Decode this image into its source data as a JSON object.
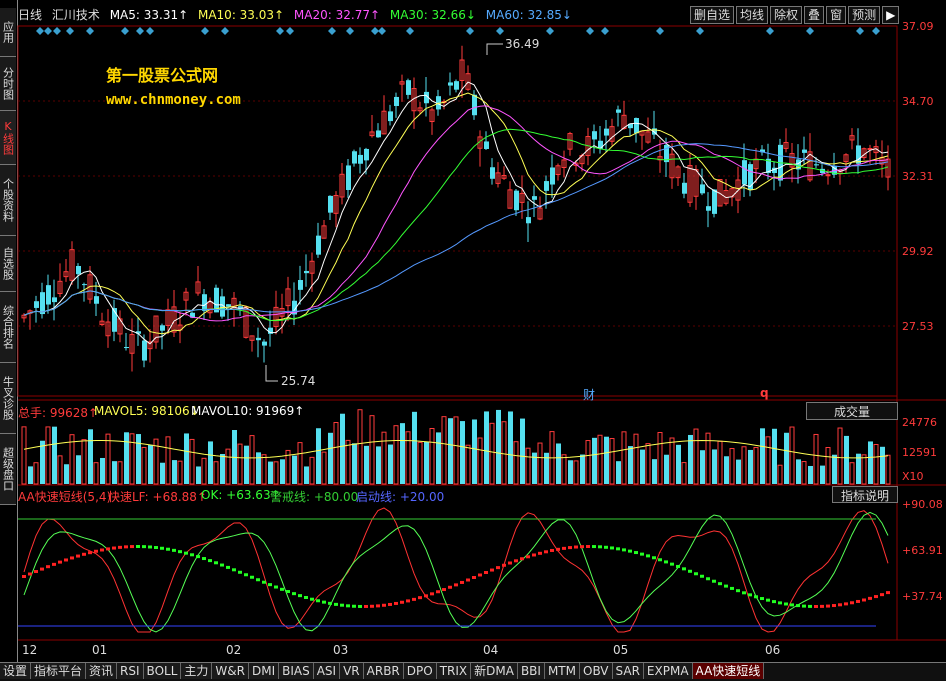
{
  "sidebar": {
    "tabs": [
      {
        "label": "应用",
        "active": false
      },
      {
        "label": "分时图",
        "active": false
      },
      {
        "label": "K线图",
        "active": true
      },
      {
        "label": "个股资料",
        "active": false
      },
      {
        "label": "自选股",
        "active": false
      },
      {
        "label": "综合排名",
        "active": false
      },
      {
        "label": "牛叉诊股",
        "active": false
      },
      {
        "label": "超级盘口",
        "active": false
      }
    ]
  },
  "header": {
    "period": "日线",
    "stock": "汇川技术",
    "ma5": "MA5: 33.31↑",
    "ma10": "MA10: 33.03↑",
    "ma20": "MA20: 32.77↑",
    "ma30": "MA30: 32.66↓",
    "ma60": "MA60: 32.85↓"
  },
  "toolbar": {
    "buttons": [
      "删自选",
      "均线",
      "除权",
      "叠",
      "窗",
      "预测"
    ],
    "arrow": "▶"
  },
  "watermark": {
    "line1": "第一股票公式网",
    "line2": "www.chnmoney.com"
  },
  "price_axis": [
    "37.09",
    "34.70",
    "32.31",
    "29.92",
    "27.53"
  ],
  "annotations": {
    "high": "36.49",
    "low": "25.74",
    "cai": "财",
    "q": "q"
  },
  "volume": {
    "total": "总手: 99628↑",
    "mavol5": "MAVOL5: 98106↓",
    "mavol10": "MAVOL10: 91969↑",
    "dropdown": "成交量",
    "axis": [
      "24776",
      "12591",
      "X10"
    ]
  },
  "indicator": {
    "title": "AA快速短线(5,4)",
    "fast": "快速LF: +68.88↑",
    "ok": "OK: +63.63↑",
    "warn": "警戒线: +80.00",
    "start": "启动线: +20.00",
    "button": "指标说明",
    "axis": [
      "+90.08",
      "+63.91",
      "+37.74"
    ]
  },
  "months": [
    "12",
    "01",
    "02",
    "03",
    "04",
    "05",
    "06"
  ],
  "bottom_tabs": [
    {
      "label": "设置",
      "active": false
    },
    {
      "label": "指标平台",
      "active": false
    },
    {
      "label": "资讯",
      "active": false
    },
    {
      "label": "RSI",
      "active": false
    },
    {
      "label": "BOLL",
      "active": false
    },
    {
      "label": "主力",
      "active": false
    },
    {
      "label": "W&R",
      "active": false
    },
    {
      "label": "DMI",
      "active": false
    },
    {
      "label": "BIAS",
      "active": false
    },
    {
      "label": "ASI",
      "active": false
    },
    {
      "label": "VR",
      "active": false
    },
    {
      "label": "ARBR",
      "active": false
    },
    {
      "label": "DPO",
      "active": false
    },
    {
      "label": "TRIX",
      "active": false
    },
    {
      "label": "新DMA",
      "active": false
    },
    {
      "label": "BBI",
      "active": false
    },
    {
      "label": "MTM",
      "active": false
    },
    {
      "label": "OBV",
      "active": false
    },
    {
      "label": "SAR",
      "active": false
    },
    {
      "label": "EXPMA",
      "active": false
    },
    {
      "label": "AA快速短线",
      "active": true
    }
  ],
  "colors": {
    "up": "#ff3b3b",
    "down": "#55e0f0",
    "ma5": "#ffffff",
    "ma10": "#ffff55",
    "ma20": "#ff55ff",
    "ma30": "#33ff33",
    "ma60": "#5599ff"
  }
}
